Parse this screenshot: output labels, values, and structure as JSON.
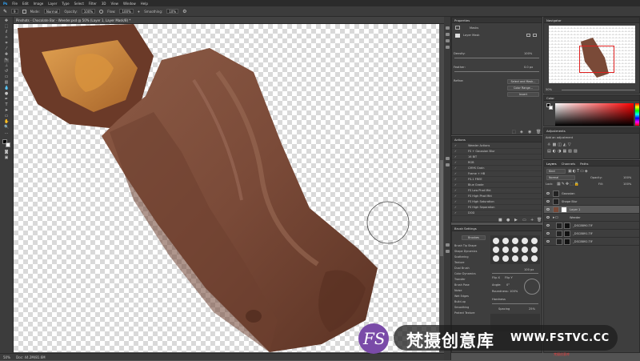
{
  "menu": [
    "Ps",
    "File",
    "Edit",
    "Image",
    "Layer",
    "Type",
    "Select",
    "Filter",
    "3D",
    "View",
    "Window",
    "Help"
  ],
  "options": {
    "size_value": "9",
    "mode_label": "Mode:",
    "mode_value": "Normal",
    "opacity_label": "Opacity:",
    "opacity_value": "100%",
    "flow_label": "Flow:",
    "flow_value": "100%",
    "smoothing_label": "Smoothing:",
    "smoothing_value": "10%"
  },
  "document_tab": "Pinshots - Chocolate Bar - Weeder.psd @ 50% (Layer 1, Layer Mask/8) *",
  "status": {
    "zoom": "50%",
    "doc": "Doc: 44.2M/81.6M"
  },
  "properties": {
    "tab": "Properties",
    "subtitle": "Masks",
    "mask_label": "Layer Mask",
    "density_label": "Density:",
    "density_value": "100%",
    "feather_label": "Feather:",
    "feather_value": "0.0 px",
    "refine_label": "Refine:",
    "select_mask_btn": "Select and Mask...",
    "color_range_btn": "Color Range...",
    "invert_btn": "Invert"
  },
  "actions": {
    "tab": "Actions",
    "items": [
      "Weeder Actions",
      "FS + Gaussian Blur",
      "16 BIT",
      "RGB",
      "CMYK Grain",
      "Frame + HB",
      "FS-1 FREE",
      "Blue Grade",
      "FS Low Phat Mkt",
      "FS High Phat Mkt",
      "FS High Saturation",
      "FS High Separation",
      "DOD"
    ]
  },
  "brush": {
    "tab": "Brush Settings",
    "tab2": "Brushes",
    "brushes_btn": "Brushes",
    "items": [
      "Brush Tip Shape",
      "Shape Dynamics",
      "Scattering",
      "Texture",
      "Dual Brush",
      "Color Dynamics",
      "Transfer",
      "Brush Pose",
      "Noise",
      "Wet Edges",
      "Build-up",
      "Smoothing",
      "Protect Texture"
    ],
    "size_value": "100 px",
    "flip_x": "Flip X",
    "flip_y": "Flip Y",
    "angle_label": "Angle:",
    "angle_value": "0°",
    "roundness_label": "Roundness:",
    "roundness_value": "100%",
    "hardness_label": "Hardness",
    "spacing_label": "Spacing",
    "spacing_value": "25%"
  },
  "navigator": {
    "tab": "Navigator",
    "zoom": "50%"
  },
  "color": {
    "tab": "Color"
  },
  "adjustments": {
    "tab": "Adjustments",
    "subtitle": "Add an adjustment"
  },
  "layers": {
    "tabs": [
      "Layers",
      "Channels",
      "Paths"
    ],
    "kind": "Kind",
    "blend": "Normal",
    "opacity_label": "Opacity:",
    "opacity_value": "100%",
    "lock_label": "Lock:",
    "fill_label": "Fill:",
    "fill_value": "100%",
    "rows": [
      "Gaussian",
      "Shape Blur",
      "Layer 1",
      "Weeder",
      "_DSC8890.TIF",
      "_DSC8891.TIF",
      "_DSC8892.TIF"
    ]
  },
  "watermark": {
    "logo_letters": "FS",
    "text": "梵摄创意库",
    "url": "WWW.FSTVC.CC",
    "small_text": "梵摄创意库"
  },
  "colors": {
    "accent": "#7a4ba8",
    "chocolate": "#7a4a36",
    "caramel": "#c98a3a",
    "panel": "#3e3e3e"
  }
}
